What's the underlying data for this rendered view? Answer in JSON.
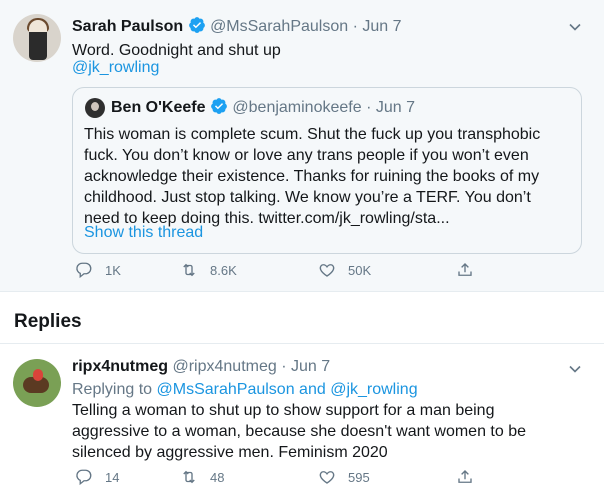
{
  "main_tweet": {
    "author_name": "Sarah Paulson",
    "author_handle": "@MsSarahPaulson",
    "separator": "·",
    "date": "Jun 7",
    "text": "Word. Goodnight and shut up",
    "mention": "@jk_rowling",
    "quote": {
      "author_name": "Ben O'Keefe",
      "author_handle": "@benjaminokeefe",
      "separator": "·",
      "date": "Jun 7",
      "lines": [
        "This woman is complete scum. Shut the fuck up you transphobic",
        "fuck. You don’t know or love any trans people if you won’t even",
        "acknowledge their existence. Thanks for ruining the books of my",
        "childhood. Just stop talking. We know you’re a TERF. You don’t",
        "need to keep doing this. twitter.com/jk_rowling/sta..."
      ],
      "show_thread": "Show this thread"
    },
    "actions": {
      "replies": "1K",
      "retweets": "8.6K",
      "likes": "50K"
    }
  },
  "replies_section": {
    "title": "Replies"
  },
  "reply": {
    "author_name": "ripx4nutmeg",
    "author_handle": "@ripx4nutmeg",
    "separator": "·",
    "date": "Jun 7",
    "replying_prefix": "Replying to",
    "replying_user1": "@MsSarahPaulson",
    "replying_and": "and",
    "replying_user2": "@jk_rowling",
    "lines": [
      "Telling a woman to shut up to show support for a man being",
      "aggressive to a woman, because she doesn't want women to be",
      "silenced by aggressive men. Feminism 2020"
    ],
    "actions": {
      "replies": "14",
      "retweets": "48",
      "likes": "595"
    }
  },
  "colors": {
    "link": "#1b95e0",
    "verified": "#1da1f2",
    "muted": "#657786"
  },
  "icons": [
    "verified-badge-icon",
    "chevron-down-icon",
    "reply-icon",
    "retweet-icon",
    "like-icon",
    "share-icon"
  ]
}
